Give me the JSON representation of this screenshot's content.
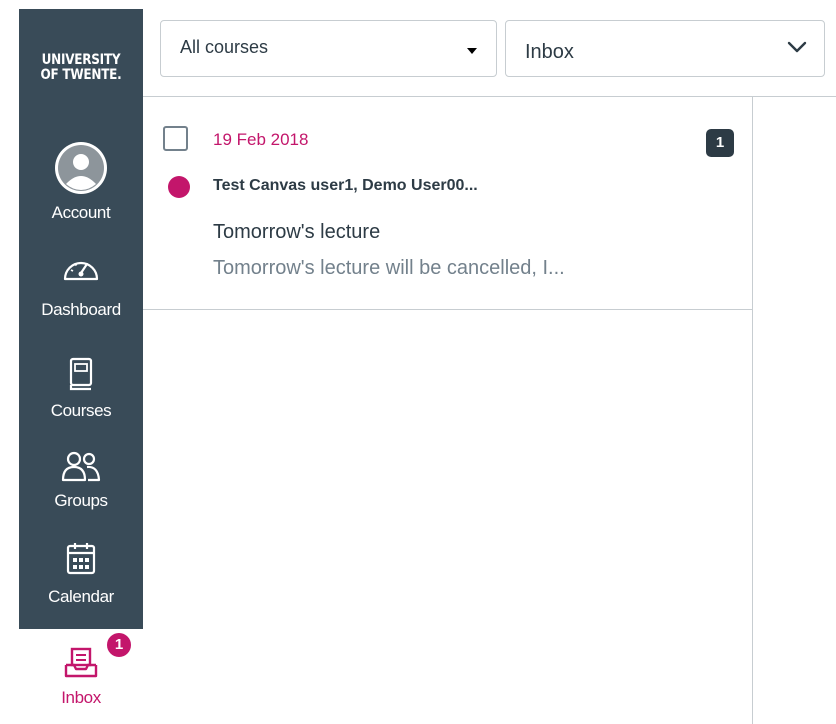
{
  "brand": {
    "logo_line1": "UNIVERSITY",
    "logo_line2": "OF TWENTE."
  },
  "global_nav": {
    "items": [
      {
        "label": "Account",
        "icon": "account-avatar-icon"
      },
      {
        "label": "Dashboard",
        "icon": "speedometer-icon"
      },
      {
        "label": "Courses",
        "icon": "book-icon"
      },
      {
        "label": "Groups",
        "icon": "people-icon"
      },
      {
        "label": "Calendar",
        "icon": "calendar-icon"
      },
      {
        "label": "Inbox",
        "icon": "inbox-icon",
        "badge": "1",
        "active": true
      }
    ],
    "colors": {
      "background": "#394b58",
      "active": "#c3166b"
    }
  },
  "filters": {
    "course_select": {
      "value": "All courses"
    },
    "mailbox_select": {
      "value": "Inbox"
    }
  },
  "conversations": [
    {
      "date": "19 Feb 2018",
      "participants": "Test Canvas user1, Demo User00...",
      "subject": "Tomorrow's lecture",
      "preview": "Tomorrow's lecture will be cancelled, I...",
      "message_count": "1",
      "unread": true,
      "selected": false
    }
  ]
}
